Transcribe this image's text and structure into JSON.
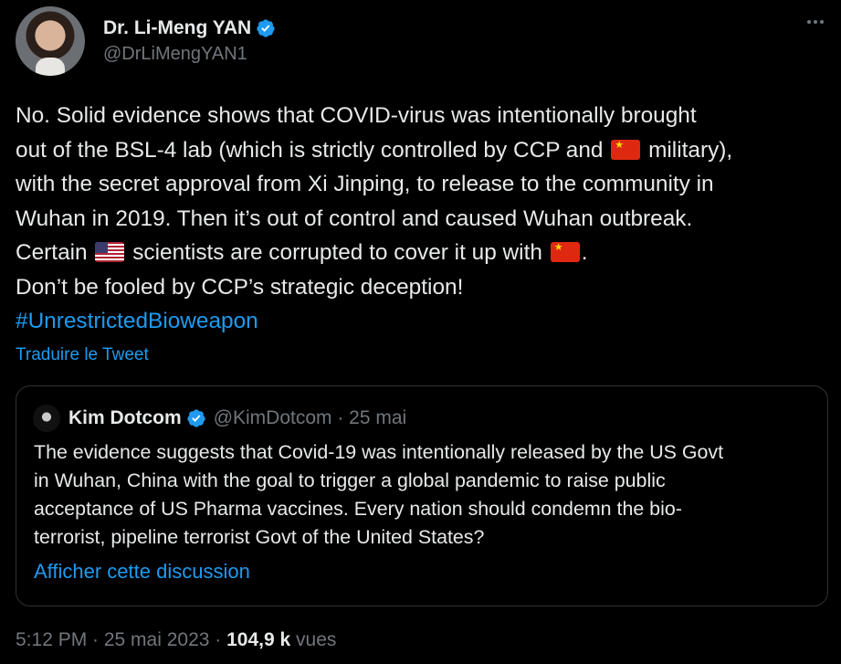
{
  "author": {
    "display_name": "Dr. Li-Meng YAN",
    "handle": "@DrLiMengYAN1"
  },
  "tweet": {
    "lines": {
      "l1": "No. Solid evidence shows that COVID-virus was intentionally brought",
      "l2a": "out of the BSL-4 lab (which is strictly controlled by CCP and",
      "l2b": "military),",
      "l3": "with the secret approval from Xi Jinping, to release to the community in",
      "l4": "Wuhan in 2019. Then it’s out of control and caused Wuhan outbreak.",
      "l5a": "Certain",
      "l5b": "scientists are corrupted to cover it up with",
      "l5c": ".",
      "l6": "Don’t be fooled by CCP’s strategic deception!"
    },
    "hashtag": "#UnrestrictedBioweapon",
    "translate_label": "Traduire le Tweet"
  },
  "quote": {
    "display_name": "Kim Dotcom",
    "handle_date": "@KimDotcom · 25 mai",
    "lines": [
      "The evidence suggests that Covid-19 was intentionally released by the US Govt",
      "in Wuhan, China with the goal to trigger a global pandemic to raise public",
      "acceptance of US Pharma vaccines. Every nation should condemn the bio-",
      "terrorist, pipeline terrorist Govt of the United States?"
    ],
    "show_thread_label": "Afficher cette discussion"
  },
  "meta": {
    "time_date": "5:12 PM · 25 mai 2023 · ",
    "views_count": "104,9 k",
    "views_label": " vues"
  },
  "colors": {
    "background": "#000000",
    "text": "#e7e9ea",
    "secondary": "#71767b",
    "link": "#1d9bf0",
    "border": "#2f3336",
    "verified": "#1d9bf0"
  },
  "icons": [
    "verified-badge-icon",
    "more-options-icon",
    "china-flag-icon",
    "usa-flag-icon"
  ]
}
